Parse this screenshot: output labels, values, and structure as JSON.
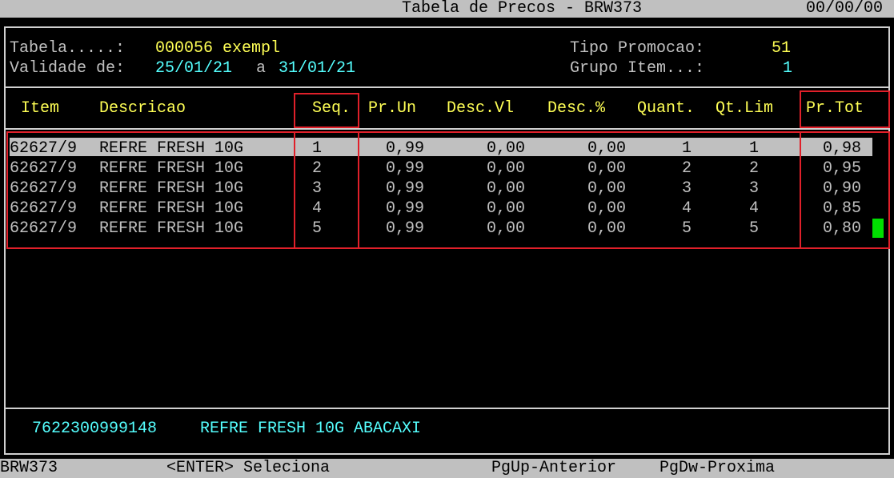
{
  "title_bar": {
    "title": "Tabela de Precos - BRW373",
    "date": "00/00/00"
  },
  "header": {
    "tabela_label": "Tabela.....:",
    "tabela_value": "000056 exempl",
    "validade_label": "Validade de:",
    "validade_from": "25/01/21",
    "validade_sep": "a",
    "validade_to": "31/01/21",
    "tipo_promocao_label": "Tipo Promocao:",
    "tipo_promocao_value": "51",
    "grupo_item_label": "Grupo Item...:",
    "grupo_item_value": "1"
  },
  "table": {
    "columns": [
      "Item",
      "Descricao",
      "Seq.",
      "Pr.Un",
      "Desc.Vl",
      "Desc.%",
      "Quant.",
      "Qt.Lim",
      "Pr.Tot"
    ],
    "rows": [
      {
        "item": "62627/9",
        "descricao": "REFRE FRESH 10G",
        "seq": "1",
        "pr_un": "0,99",
        "desc_vl": "0,00",
        "desc_pct": "0,00",
        "quant": "1",
        "qt_lim": "1",
        "pr_tot": "0,98"
      },
      {
        "item": "62627/9",
        "descricao": "REFRE FRESH 10G",
        "seq": "2",
        "pr_un": "0,99",
        "desc_vl": "0,00",
        "desc_pct": "0,00",
        "quant": "2",
        "qt_lim": "2",
        "pr_tot": "0,95"
      },
      {
        "item": "62627/9",
        "descricao": "REFRE FRESH 10G",
        "seq": "3",
        "pr_un": "0,99",
        "desc_vl": "0,00",
        "desc_pct": "0,00",
        "quant": "3",
        "qt_lim": "3",
        "pr_tot": "0,90"
      },
      {
        "item": "62627/9",
        "descricao": "REFRE FRESH 10G",
        "seq": "4",
        "pr_un": "0,99",
        "desc_vl": "0,00",
        "desc_pct": "0,00",
        "quant": "4",
        "qt_lim": "4",
        "pr_tot": "0,85"
      },
      {
        "item": "62627/9",
        "descricao": "REFRE FRESH 10G",
        "seq": "5",
        "pr_un": "0,99",
        "desc_vl": "0,00",
        "desc_pct": "0,00",
        "quant": "5",
        "qt_lim": "5",
        "pr_tot": "0,80"
      }
    ]
  },
  "detail": {
    "ean": "7622300999148",
    "description": "REFRE FRESH 10G ABACAXI"
  },
  "status_bar": {
    "program": "BRW373",
    "enter_hint": "<ENTER> Seleciona",
    "pgup_hint": "PgUp-Anterior",
    "pgdw_hint": "PgDw-Proxima"
  },
  "colors": {
    "background": "#000000",
    "bar": "#c0c0c0",
    "label": "#c0c0c0",
    "header_text": "#ffff55",
    "value_text": "#55ffff",
    "highlight_box": "#e0202a",
    "cursor": "#00e000"
  }
}
